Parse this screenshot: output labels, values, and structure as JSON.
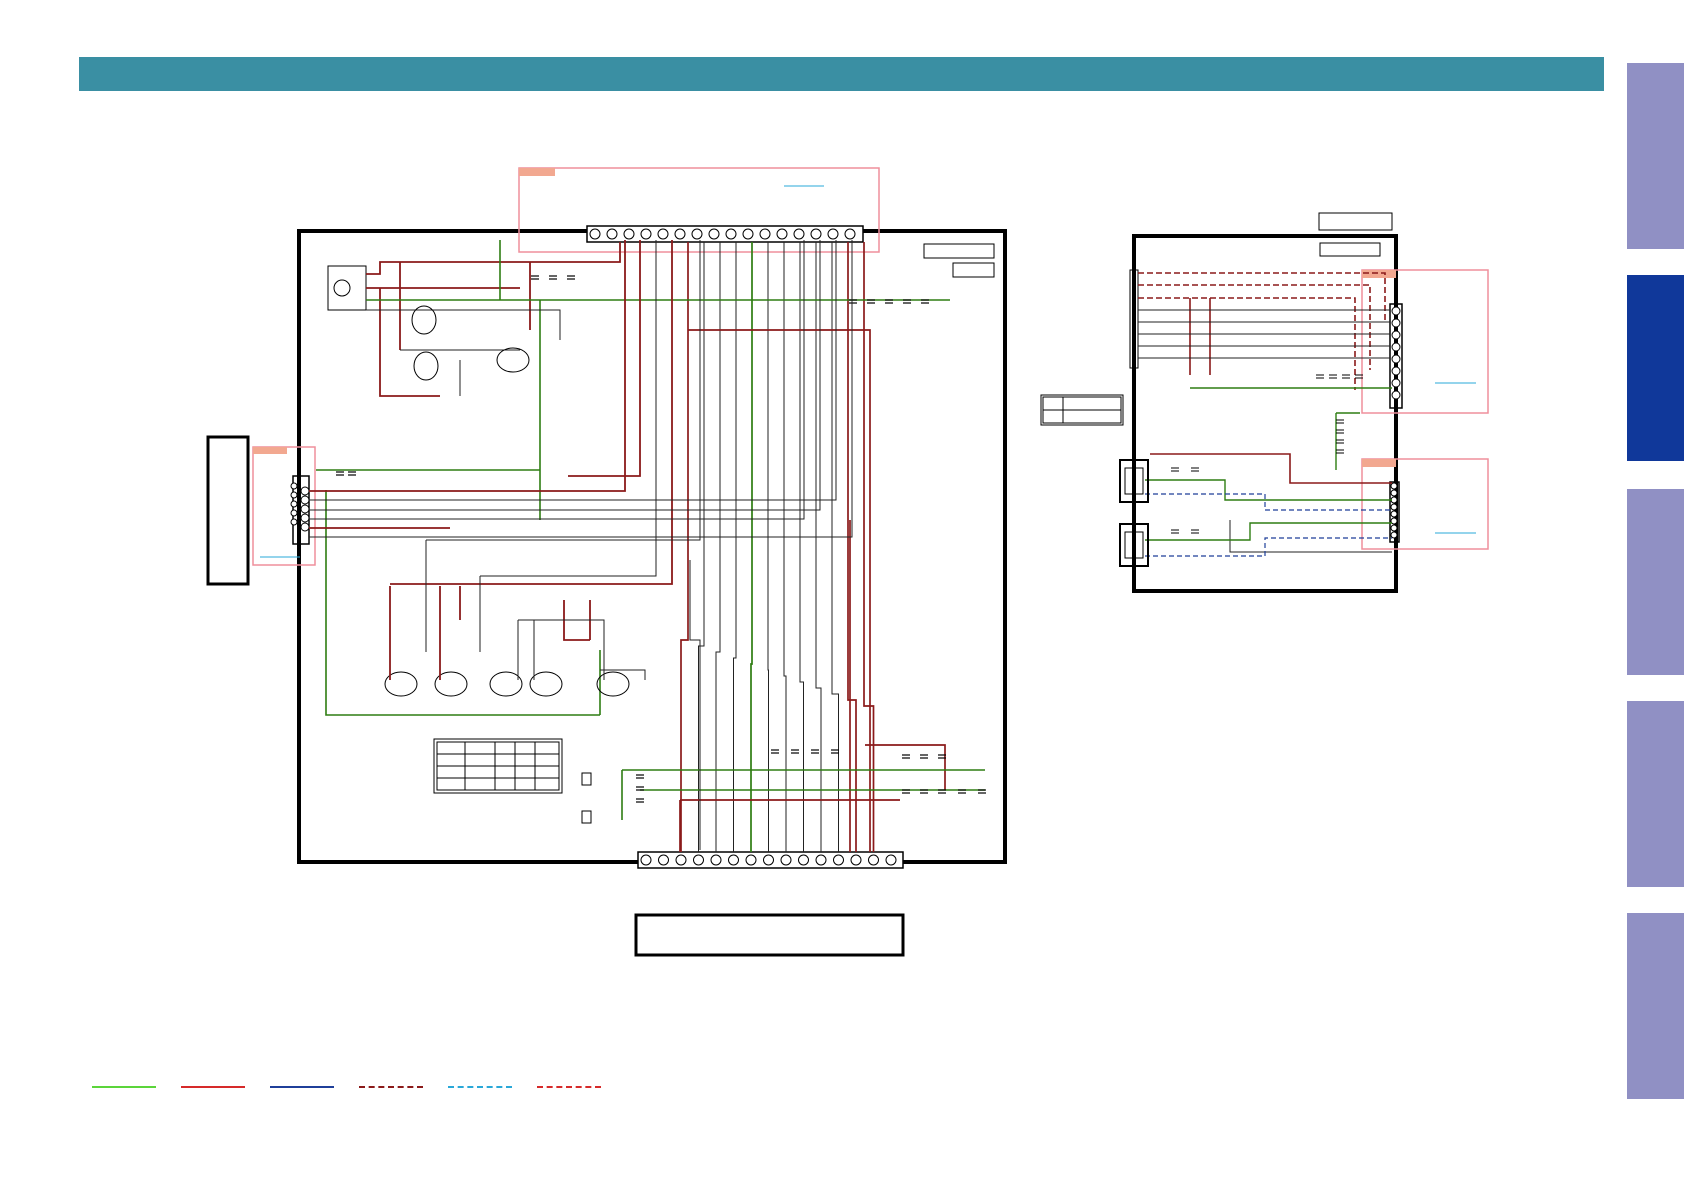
{
  "colors": {
    "header": "#3a8fa3",
    "tab_inactive": "#9090c4",
    "tab_active": "#10389a",
    "wire_green": "#2e7d12",
    "wire_red": "#8b1a1a",
    "wire_black": "#222222",
    "wire_blue": "#1f3f99",
    "wire_cyan": "#2aa8d8",
    "callout_pink": "#ef8f9c",
    "callout_tab": "#f2a890"
  },
  "header": {
    "title": ""
  },
  "side_tabs": [
    {
      "label": "",
      "active": false
    },
    {
      "label": "",
      "active": true
    },
    {
      "label": "",
      "active": false
    },
    {
      "label": "",
      "active": false
    },
    {
      "label": "",
      "active": false
    }
  ],
  "legend": [
    {
      "color": "#5bd53a",
      "style": "solid",
      "label": ""
    },
    {
      "color": "#d62a2a",
      "style": "solid",
      "label": ""
    },
    {
      "color": "#1f3f99",
      "style": "solid",
      "label": ""
    },
    {
      "color": "#8b1a1a",
      "style": "dashed",
      "label": ""
    },
    {
      "color": "#2aa8d8",
      "style": "dashed",
      "label": ""
    },
    {
      "color": "#d62a2a",
      "style": "dashed",
      "label": ""
    }
  ],
  "icons": {
    "resistor": "resistor-icon",
    "capacitor": "capacitor-icon",
    "transistor": "transistor-icon",
    "connector": "connector-icon",
    "jack": "audio-jack-icon"
  }
}
